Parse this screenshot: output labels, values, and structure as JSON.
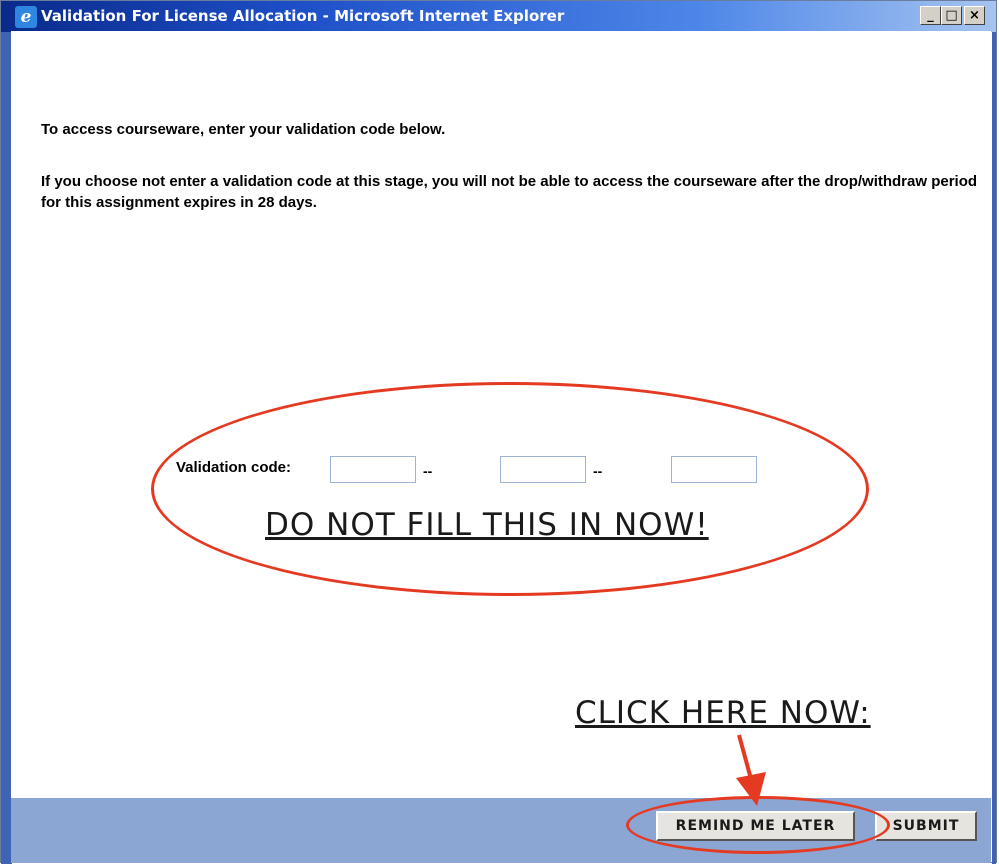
{
  "window": {
    "title": "Validation For License Allocation - Microsoft Internet Explorer",
    "app_icon_glyph": "e",
    "controls": {
      "minimize": "_",
      "maximize": "□",
      "close": "×"
    }
  },
  "content": {
    "instruction": "To access courseware, enter your validation code below.",
    "warning": "If you choose not enter a validation code at this stage, you will not be able to access the courseware after the drop/withdraw period for this assignment expires in 28 days.",
    "validation_label": "Validation code:",
    "separator": "--",
    "code_fields": [
      {
        "value": "",
        "placeholder": ""
      },
      {
        "value": "",
        "placeholder": ""
      },
      {
        "value": "",
        "placeholder": ""
      }
    ]
  },
  "annotations": {
    "do_not_fill": "DO NOT FILL THIS IN NOW!",
    "click_here": "CLICK HERE NOW:",
    "highlight_color": "#e43a22"
  },
  "footer": {
    "remind_label": "REMIND ME LATER",
    "submit_label": "SUBMIT"
  },
  "colors": {
    "titlebar_start": "#0a2a8a",
    "footer_bg": "#8ca6d4"
  }
}
